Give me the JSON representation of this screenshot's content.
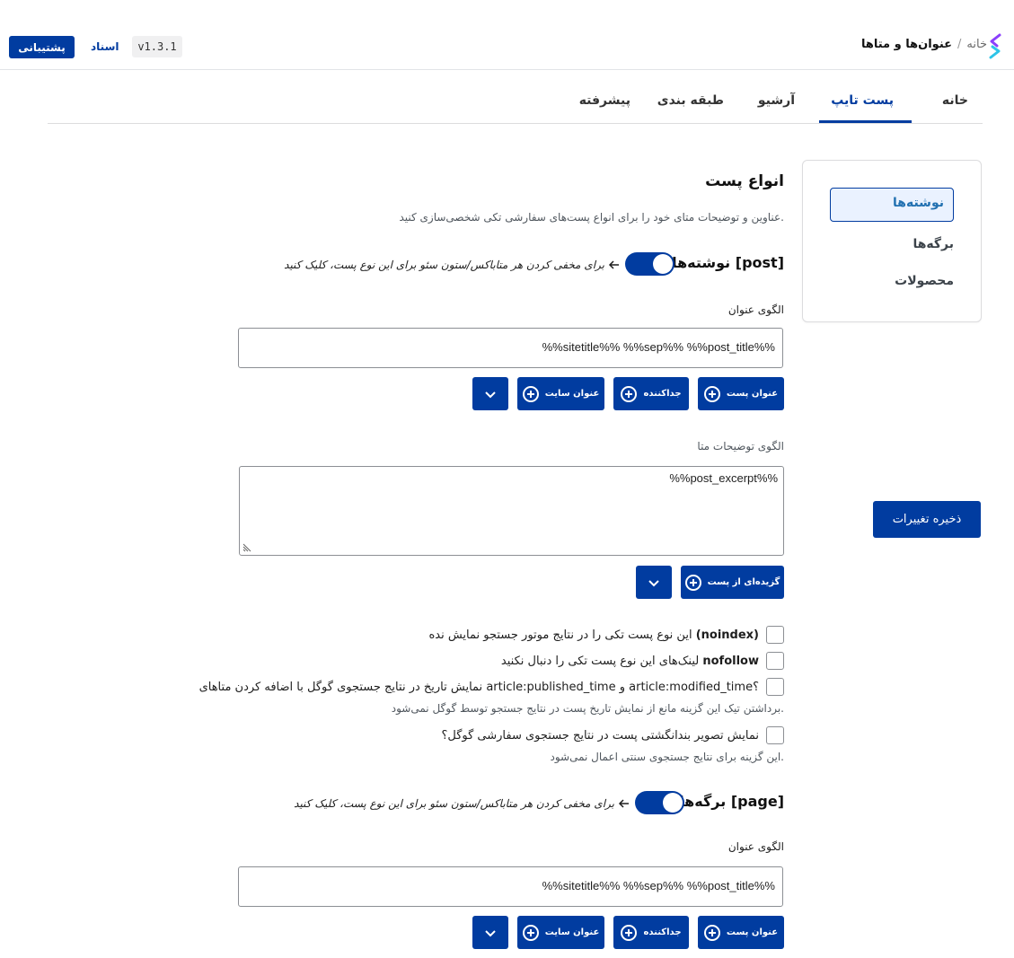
{
  "header": {
    "breadcrumb_home": "خانه",
    "breadcrumb_sep": "/",
    "breadcrumb_current": "عنوان‌ها و متاها",
    "support_label": "پشتیبانی",
    "docs_label": "اسناد",
    "version": "v1.3.1"
  },
  "tabs": [
    {
      "label": "خانه"
    },
    {
      "label": "پست تایپ"
    },
    {
      "label": "آرشیو"
    },
    {
      "label": "طبقه بندی"
    },
    {
      "label": "پیشرفته"
    }
  ],
  "active_tab": "پست تایپ",
  "sidebar": {
    "items": [
      {
        "label": "نوشته‌ها"
      },
      {
        "label": "برگه‌ها"
      },
      {
        "label": "محصولات"
      }
    ],
    "active": "نوشته‌ها"
  },
  "save_label": "ذخیره تغییرات",
  "main": {
    "title": "انواع پست",
    "description": "عناوین و توضیحات متای خود را برای انواع پست‌های سفارشی تکی شخصی‌سازی کنید.",
    "posts": {
      "title": "نوشته‌ها [post]",
      "toggle_hint": "برای مخفی کردن هر متاباکس/ستون سئو برای این نوع پست، کلیک کنید",
      "toggle_on": true,
      "title_label": "الگوی عنوان",
      "title_value": "%%sitetitle%% %%sep%% %%post_title%%",
      "var_post_title": "عنوان پست",
      "var_separator": "جداکننده",
      "var_site_title": "عنوان سایت",
      "meta_label": "الگوی توضیحات متا",
      "meta_value": "%%post_excerpt%%",
      "var_excerpt": "گزیده‌ای از پست",
      "cb_noindex_text": "این نوع پست تکی را در نتایج موتور جستجو نمایش نده",
      "cb_noindex_bold": "(noindex)",
      "cb_nofollow_text": "لینک‌های این نوع پست تکی را دنبال نکنید",
      "cb_nofollow_bold": "nofollow",
      "cb_date_text": "نمایش تاریخ در نتایج جستجوی گوگل با اضافه کردن متاهای article:published_time و article:modified_time؟",
      "cb_date_note": "برداشتن تیک این گزینه مانع از نمایش تاریخ پست در نتایج جستجو توسط گوگل نمی‌شود.",
      "cb_thumb_text": "نمایش تصویر بندانگشتی پست در نتایج جستجوی سفارشی گوگل؟",
      "cb_thumb_note": "این گزینه برای نتایج جستجوی سنتی اعمال نمی‌شود."
    },
    "pages": {
      "title": "برگه‌ها [page]",
      "toggle_hint": "برای مخفی کردن هر متاباکس/ستون سئو برای این نوع پست، کلیک کنید",
      "toggle_on": true,
      "title_label": "الگوی عنوان",
      "title_value": "%%sitetitle%% %%sep%% %%post_title%%",
      "var_post_title": "عنوان پست",
      "var_separator": "جداکننده",
      "var_site_title": "عنوان سایت"
    }
  },
  "colors": {
    "primary": "#013ca0",
    "link": "#2271b1",
    "active_bg": "#eaf2ff",
    "border": "#8c8f94"
  },
  "icons": [
    "logo-icon",
    "plus-circle-icon",
    "chevron-down-icon",
    "arrow-left-icon",
    "resize-handle-icon"
  ]
}
